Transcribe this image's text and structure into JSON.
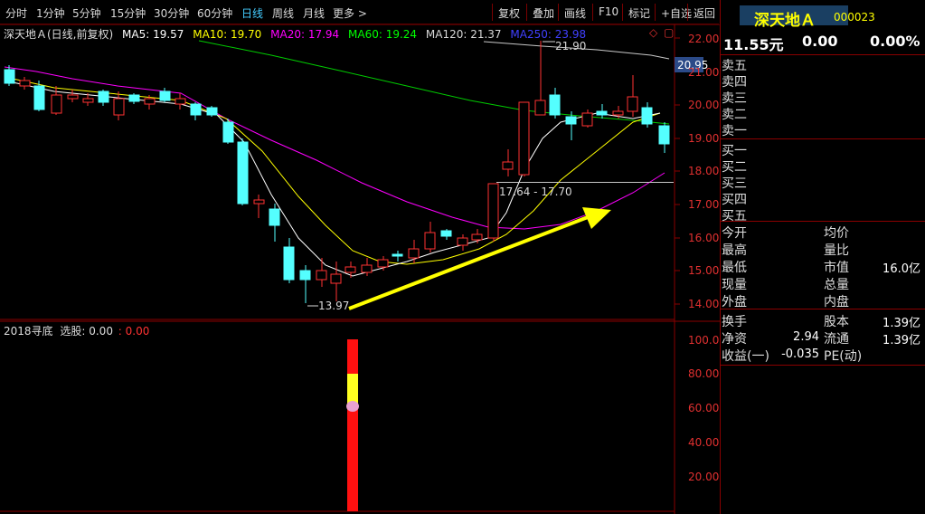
{
  "toolbar": {
    "period_tabs": [
      "分时",
      "1分钟",
      "5分钟",
      "15分钟",
      "30分钟",
      "60分钟",
      "日线",
      "周线",
      "月线",
      "更多 >"
    ],
    "active_tab": "日线",
    "right_buttons": [
      "复权",
      "叠加",
      "画线",
      "F10",
      "标记",
      "+自选",
      "返回"
    ]
  },
  "header": {
    "stock_name": "深天地Ａ",
    "stock_code": "000023",
    "price": "11.55元",
    "change": "0.00",
    "change_pct": "0.00%"
  },
  "main_chart": {
    "title": "深天地Ａ(日线,前复权)",
    "ma_legend": [
      {
        "label": "MA5: 19.57",
        "color": "#ffffff"
      },
      {
        "label": "MA10: 19.70",
        "color": "#ffff00"
      },
      {
        "label": "MA20: 17.94",
        "color": "#ff00ff"
      },
      {
        "label": "MA60: 19.24",
        "color": "#00ff00"
      },
      {
        "label": "MA120: 21.37",
        "color": "#d8d8d8"
      },
      {
        "label": "MA250: 23.98",
        "color": "#3030ff"
      }
    ],
    "y_ticks": [
      "22.00",
      "21.00",
      "20.00",
      "19.00",
      "18.00",
      "17.00",
      "16.00",
      "15.00",
      "14.00"
    ],
    "current_price_tag": "20.95",
    "annot_high": "21.90",
    "annot_low": "13.97",
    "annot_range": "17.64 - 17.70"
  },
  "indicator": {
    "title": "2018寻底",
    "select_label": "选股: 0.00",
    "select_value": ": 0.00",
    "y_ticks": [
      "100.0",
      "80.00",
      "60.00",
      "40.00",
      "20.00"
    ]
  },
  "orders": {
    "sell": [
      "卖五",
      "卖四",
      "卖三",
      "卖二",
      "卖一"
    ],
    "buy": [
      "买一",
      "买二",
      "买三",
      "买四",
      "买五"
    ]
  },
  "info": {
    "left_labels": [
      "今开",
      "最高",
      "最低",
      "现量",
      "外盘"
    ],
    "right_labels": [
      "均价",
      "量比",
      "市值",
      "总量",
      "内盘"
    ],
    "market_cap": "16.0亿",
    "bottom_left": [
      "换手",
      "净资",
      "收益(一)"
    ],
    "bottom_mid": [
      "股本",
      "流通",
      "PE(动)"
    ],
    "net_asset": "2.94",
    "eps": "-0.035",
    "total_shares": "1.39亿",
    "float_shares": "1.39亿"
  },
  "colors": {
    "up": "#ff3232",
    "down": "#54ffff",
    "grid_border": "#8a0000",
    "axis_text": "#e03030"
  }
}
